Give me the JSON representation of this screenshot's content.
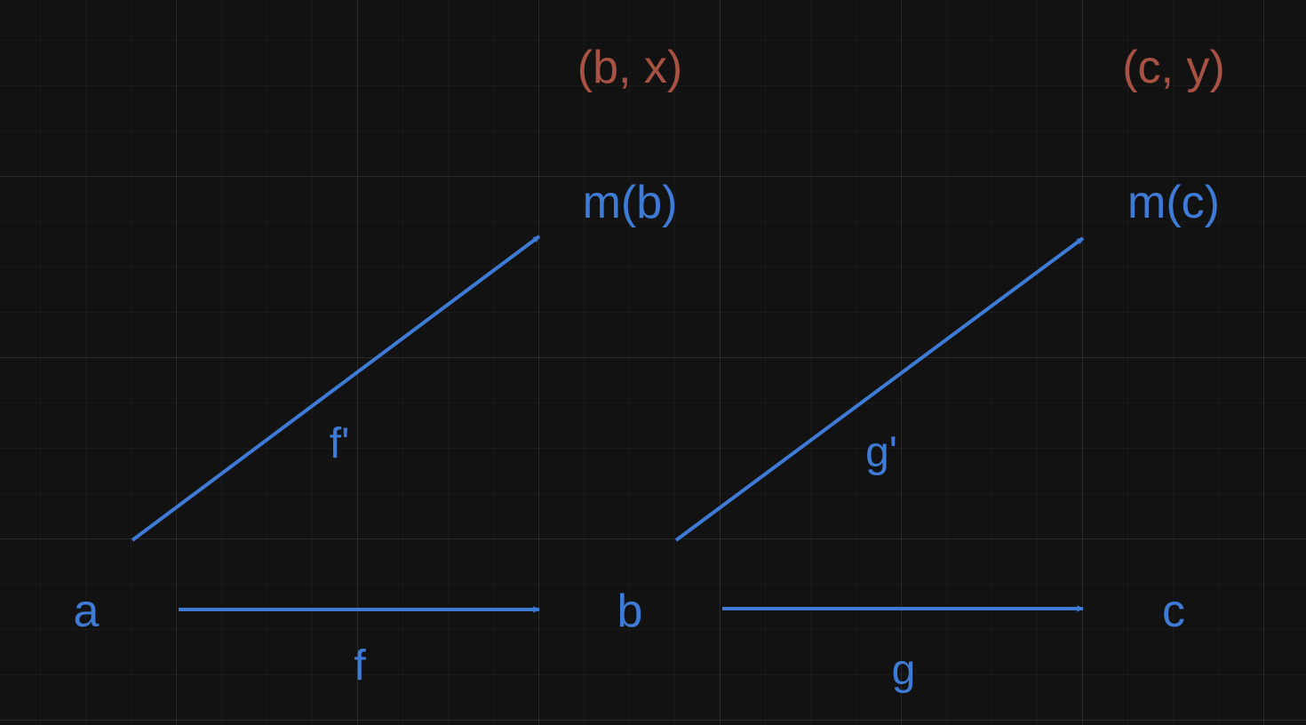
{
  "colors": {
    "background": "#121212",
    "primary": "#3e7bd6",
    "secondary": "#a85243"
  },
  "nodes": {
    "a": "a",
    "b": "b",
    "c": "c",
    "mb": "m(b)",
    "mc": "m(c)"
  },
  "pairs": {
    "bx": "(b, x)",
    "cy": "(c, y)"
  },
  "edges": {
    "f": "f",
    "g": "g",
    "f_prime": "f'",
    "g_prime": "g'"
  }
}
